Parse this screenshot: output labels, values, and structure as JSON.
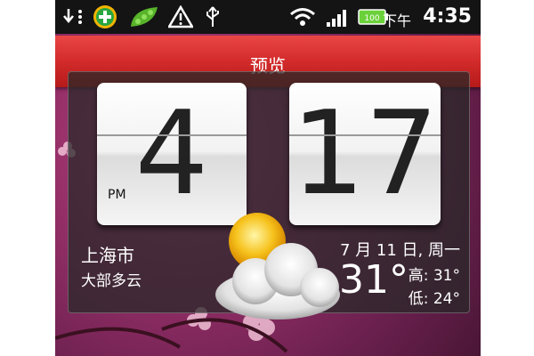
{
  "status_bar": {
    "icons": [
      "download-usb-icon",
      "plus-badge-icon",
      "peapod-icon",
      "warning-icon",
      "usb-icon",
      "wifi-icon",
      "signal-icon",
      "battery-icon"
    ],
    "battery_level": "100",
    "time_label": "下午",
    "time": "4:35"
  },
  "header": {
    "title": "预览"
  },
  "clock": {
    "hour": "4",
    "minutes": "17",
    "period": "PM"
  },
  "weather": {
    "city": "上海市",
    "condition": "大部多云",
    "date": "7 月 11 日, 周一",
    "temperature": "31°",
    "high": "高: 31°",
    "low": "低: 24°",
    "icon": "partly-cloudy-icon"
  },
  "colors": {
    "titlebar": "#d32b2b",
    "statusbar": "#141414",
    "wallpaper": "#98306a"
  }
}
